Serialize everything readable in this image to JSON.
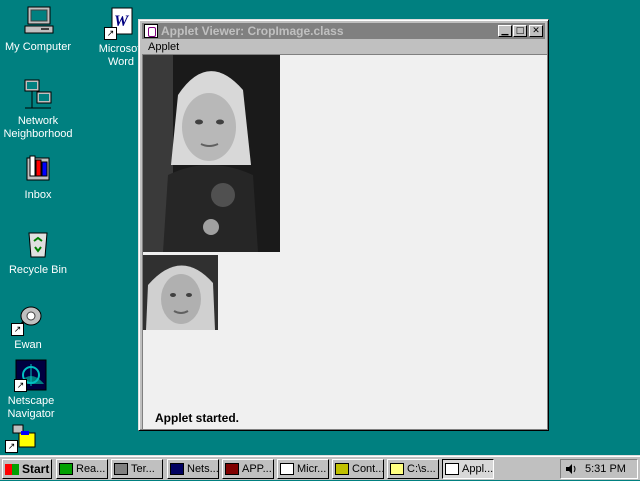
{
  "desktop": {
    "icons": [
      {
        "label": "My Computer"
      },
      {
        "label": "Microsoft\nWord"
      },
      {
        "label": "Network\nNeighborhood"
      },
      {
        "label": "Inbox"
      },
      {
        "label": "Recycle Bin"
      },
      {
        "label": "Ewan"
      },
      {
        "label": "Netscape\nNavigator"
      }
    ]
  },
  "window": {
    "title": "Applet Viewer: CropImage.class",
    "menu": [
      "Applet"
    ],
    "status": "Applet started."
  },
  "taskbar": {
    "start_label": "Start",
    "buttons": [
      {
        "label": "Rea..."
      },
      {
        "label": "Ter..."
      },
      {
        "label": "Nets..."
      },
      {
        "label": "APP..."
      },
      {
        "label": "Micr..."
      },
      {
        "label": "Cont..."
      },
      {
        "label": "C:\\s..."
      },
      {
        "label": "Appl..."
      }
    ],
    "clock": "5:31 PM"
  },
  "colors": {
    "desktop": "#008080",
    "titlebar_inactive": "#808080",
    "face": "#c0c0c0"
  }
}
